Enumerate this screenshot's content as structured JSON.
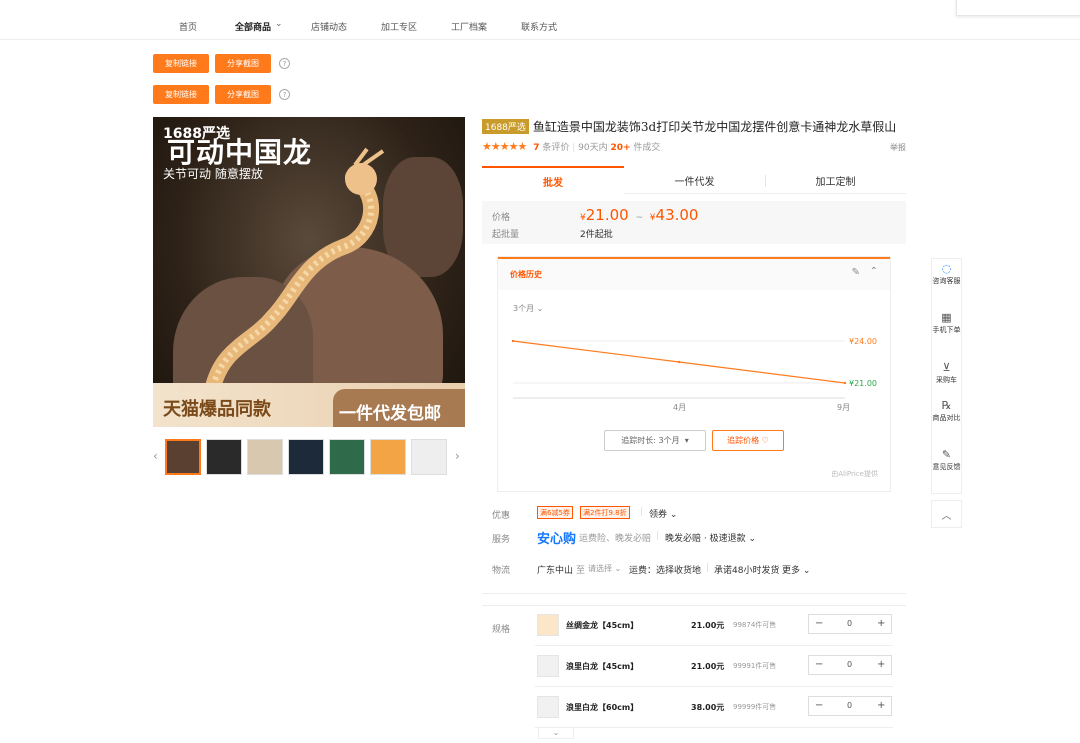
{
  "nav": {
    "items": [
      "首页",
      "全部商品",
      "店铺动态",
      "加工专区",
      "工厂档案",
      "联系方式"
    ],
    "all_products_chevron": "chevron-down-icon"
  },
  "toolbar": {
    "copy_link": "复制链接",
    "share_screenshot": "分享截图",
    "help_icon": "?"
  },
  "gallery": {
    "brand_tag": "1688严选",
    "headline": "可动中国龙",
    "subline": "关节可动 随意摆放",
    "tmall_text": "天猫爆品同款",
    "dropship_text": "一件代发包邮",
    "thumb_count": 7
  },
  "product": {
    "badge": "1688严选",
    "title": "鱼缸造景中国龙装饰3d打印关节龙中国龙摆件创意卡通神龙水草假山",
    "rating_stars": "★★★★★",
    "review_count": "7",
    "review_label": "条评价",
    "sold_period": "90天内",
    "sold_count": "20+",
    "sold_label": "件成交",
    "report": "举报"
  },
  "tabs": [
    "批发",
    "一件代发",
    "加工定制"
  ],
  "price": {
    "label": "价格",
    "low": "21.00",
    "high": "43.00",
    "currency": "¥",
    "separator": "~",
    "moq_label": "起批量",
    "moq_value": "2件起批"
  },
  "price_history": {
    "title": "价格历史",
    "period": "3个月",
    "edit_icon": "pencil-icon",
    "collapse_icon": "chevron-up-icon",
    "duration_btn": "追踪时长: 3个月",
    "track_btn": "追踪价格",
    "powered_by": "由AliPrice提供",
    "accent": "#ff7a1a"
  },
  "chart_data": {
    "type": "line",
    "x": [
      "",
      "4月",
      "9月"
    ],
    "series": [
      {
        "values": [
          24.0,
          22.5,
          21.0
        ]
      }
    ],
    "annotations": [
      "¥24.00",
      "¥21.00"
    ],
    "ylim": [
      20,
      25
    ],
    "grid": true
  },
  "promo": {
    "label": "优惠",
    "coupons": [
      "满6减5券",
      "满2件打9.8折"
    ],
    "claim": "领券"
  },
  "service": {
    "label": "服务",
    "anxin": "安心购",
    "details": "运费险、晚发必赔",
    "extra": "晚发必赔 · 极速退款"
  },
  "logistics": {
    "label": "物流",
    "from": "广东中山",
    "to_label": "至",
    "to_select": "请选择",
    "shipping": "运费：选择收货地",
    "promise": "承诺48小时发货",
    "more": "更多"
  },
  "sku": {
    "label": "规格",
    "items": [
      {
        "name": "丝绸金龙【45cm】",
        "price": "21.00元",
        "stock": "99874件可售",
        "qty": "0"
      },
      {
        "name": "浪里白龙【45cm】",
        "price": "21.00元",
        "stock": "99991件可售",
        "qty": "0"
      },
      {
        "name": "浪里白龙【60cm】",
        "price": "38.00元",
        "stock": "99999件可售",
        "qty": "0"
      }
    ]
  },
  "sidebar": {
    "items": [
      {
        "label": "咨询客服",
        "icon": "chat-icon"
      },
      {
        "label": "手机下单",
        "icon": "qr-code-icon"
      },
      {
        "label": "采购车",
        "icon": "cart-icon"
      },
      {
        "label": "商品对比",
        "icon": "compare-icon"
      },
      {
        "label": "意见反馈",
        "icon": "edit-icon"
      }
    ]
  }
}
